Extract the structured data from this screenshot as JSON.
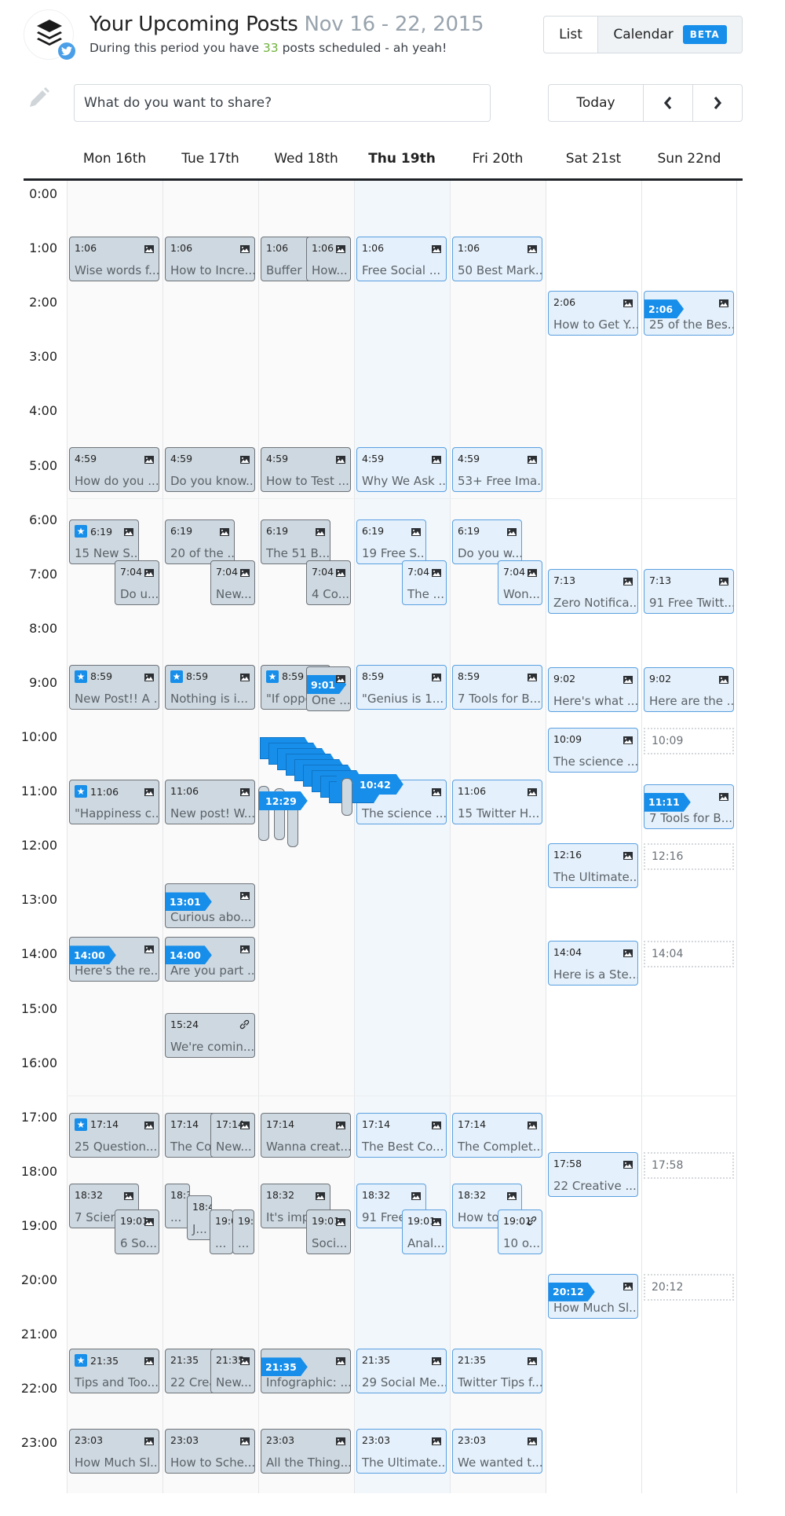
{
  "header": {
    "title": "Your Upcoming Posts",
    "date_range": "Nov 16 - 22, 2015",
    "subtitle_prefix": "During this period you have",
    "post_count": "33",
    "subtitle_suffix": "posts scheduled - ah yeah!",
    "avatar_icon": "buffer-logo-icon",
    "network_badge_icon": "twitter-icon"
  },
  "view_toggle": {
    "list_label": "List",
    "calendar_label": "Calendar",
    "badge": "BETA",
    "active": "Calendar"
  },
  "composer": {
    "icon": "pencil-icon",
    "placeholder": "What do you want to share?",
    "value": ""
  },
  "nav": {
    "today_label": "Today",
    "prev_icon": "chevron-left-icon",
    "next_icon": "chevron-right-icon"
  },
  "colors": {
    "accent": "#168eea",
    "count_green": "#6fb23b",
    "past_event_bg": "#ced8e0",
    "future_event_bg": "#e4f0fb"
  },
  "calendar": {
    "days": [
      {
        "label": "Mon 16th",
        "state": "past"
      },
      {
        "label": "Tue 17th",
        "state": "past"
      },
      {
        "label": "Wed 18th",
        "state": "past"
      },
      {
        "label": "Thu 19th",
        "state": "today"
      },
      {
        "label": "Fri 20th",
        "state": "future"
      },
      {
        "label": "Sat 21st",
        "state": "weekend"
      },
      {
        "label": "Sun 22nd",
        "state": "weekend"
      }
    ],
    "hours": [
      "0:00",
      "1:00",
      "2:00",
      "3:00",
      "4:00",
      "5:00",
      "6:00",
      "7:00",
      "8:00",
      "9:00",
      "10:00",
      "11:00",
      "12:00",
      "13:00",
      "14:00",
      "15:00",
      "16:00",
      "17:00",
      "18:00",
      "19:00",
      "20:00",
      "21:00",
      "22:00",
      "23:00"
    ],
    "events": [
      {
        "day": 0,
        "time": "1:06",
        "text": "Wise words f...",
        "icon": "image-icon"
      },
      {
        "day": 1,
        "time": "1:06",
        "text": "How to Incre...",
        "icon": "image-icon"
      },
      {
        "day": 2,
        "time": "1:06",
        "text": "Buffer c",
        "icon": "image-icon",
        "lane": 0
      },
      {
        "day": 2,
        "time": "1:06",
        "text": "How...",
        "icon": "image-icon",
        "lane": "right-narrow"
      },
      {
        "day": 3,
        "time": "1:06",
        "text": "Free Social ...",
        "icon": "image-icon"
      },
      {
        "day": 4,
        "time": "1:06",
        "text": "50 Best Mark...",
        "icon": "image-icon"
      },
      {
        "day": 5,
        "time": "2:06",
        "text": "How to Get Y...",
        "icon": "image-icon"
      },
      {
        "day": 6,
        "time": "2:06",
        "text": "25 of the Bes...",
        "icon": "image-icon",
        "flag": true
      },
      {
        "day": 0,
        "time": "4:59",
        "text": "How do you ...",
        "icon": "image-icon"
      },
      {
        "day": 1,
        "time": "4:59",
        "text": "Do you know...",
        "icon": "image-icon"
      },
      {
        "day": 2,
        "time": "4:59",
        "text": "How to Test ...",
        "icon": "image-icon"
      },
      {
        "day": 3,
        "time": "4:59",
        "text": "Why We Ask ...",
        "icon": "image-icon"
      },
      {
        "day": 4,
        "time": "4:59",
        "text": "53+ Free Ima...",
        "icon": "image-icon"
      },
      {
        "day": 0,
        "time": "6:19",
        "text": "15 New S...",
        "icon": "image-icon",
        "star": true,
        "lane": "left-wide"
      },
      {
        "day": 0,
        "time": "7:04",
        "text": "Do u...",
        "icon": "image-icon",
        "lane": "right-narrow"
      },
      {
        "day": 1,
        "time": "6:19",
        "text": "20 of the ...",
        "icon": "image-icon",
        "lane": "left-wide"
      },
      {
        "day": 1,
        "time": "7:04",
        "text": "New...",
        "icon": "image-icon",
        "lane": "right-narrow"
      },
      {
        "day": 2,
        "time": "6:19",
        "text": "The 51 B...",
        "icon": "image-icon",
        "lane": "left-wide"
      },
      {
        "day": 2,
        "time": "7:04",
        "text": "4 Co...",
        "icon": "image-icon",
        "lane": "right-narrow"
      },
      {
        "day": 3,
        "time": "6:19",
        "text": "19 Free S...",
        "icon": "image-icon",
        "lane": "left-wide"
      },
      {
        "day": 3,
        "time": "7:04",
        "text": "The ...",
        "icon": "image-icon",
        "lane": "right-narrow"
      },
      {
        "day": 4,
        "time": "6:19",
        "text": "Do you w...",
        "icon": "image-icon",
        "lane": "left-wide"
      },
      {
        "day": 4,
        "time": "7:04",
        "text": "Won...",
        "icon": "image-icon",
        "lane": "right-narrow"
      },
      {
        "day": 5,
        "time": "7:13",
        "text": "Zero Notifica...",
        "icon": "image-icon"
      },
      {
        "day": 6,
        "time": "7:13",
        "text": "91 Free Twitt...",
        "icon": "image-icon"
      },
      {
        "day": 0,
        "time": "8:59",
        "text": "New Post!! A ...",
        "icon": "image-icon",
        "star": true
      },
      {
        "day": 1,
        "time": "8:59",
        "text": "Nothing is i...",
        "icon": "image-icon",
        "star": true
      },
      {
        "day": 2,
        "time": "8:59",
        "text": "\"If oppo",
        "icon": "image-icon",
        "star": true,
        "lane": "left-wide"
      },
      {
        "day": 2,
        "time": "9:01",
        "text": "One ...",
        "icon": "image-icon",
        "flag": true,
        "lane": "right-narrow"
      },
      {
        "day": 3,
        "time": "8:59",
        "text": "\"Genius is 1...",
        "icon": "image-icon"
      },
      {
        "day": 4,
        "time": "8:59",
        "text": "7 Tools for B...",
        "icon": "image-icon"
      },
      {
        "day": 5,
        "time": "9:02",
        "text": "Here's what ...",
        "icon": "image-icon"
      },
      {
        "day": 6,
        "time": "9:02",
        "text": "Here are the ...",
        "icon": "image-icon"
      },
      {
        "day": 5,
        "time": "10:09",
        "text": "The science ...",
        "icon": "image-icon"
      },
      {
        "day": 0,
        "time": "11:06",
        "text": "\"Happiness c...",
        "icon": "image-icon",
        "star": true
      },
      {
        "day": 1,
        "time": "11:06",
        "text": "New post! W...",
        "icon": "image-icon"
      },
      {
        "day": 3,
        "time": "11:06",
        "text": "The science ...",
        "icon": "image-icon"
      },
      {
        "day": 4,
        "time": "11:06",
        "text": "15 Twitter H...",
        "icon": "image-icon"
      },
      {
        "day": 6,
        "time": "11:11",
        "text": "7 Tools for B...",
        "icon": "image-icon",
        "flag": true
      },
      {
        "day": 5,
        "time": "12:16",
        "text": "The Ultimate...",
        "icon": "image-icon"
      },
      {
        "day": 1,
        "time": "13:01",
        "text": "Curious abo...",
        "icon": "image-icon",
        "flag": true
      },
      {
        "day": 0,
        "time": "14:00",
        "text": "Here's the re...",
        "icon": "image-icon",
        "flag": true
      },
      {
        "day": 1,
        "time": "14:00",
        "text": "Are you part ...",
        "icon": "image-icon",
        "flag": true
      },
      {
        "day": 5,
        "time": "14:04",
        "text": "Here is a Ste...",
        "icon": "image-icon"
      },
      {
        "day": 1,
        "time": "15:24",
        "text": "We're comin...",
        "icon": "link-icon"
      },
      {
        "day": 0,
        "time": "17:14",
        "text": "25 Question...",
        "icon": "image-icon",
        "star": true
      },
      {
        "day": 1,
        "time": "17:14",
        "text": "The Cor",
        "icon": "image-icon",
        "lane": 0
      },
      {
        "day": 1,
        "time": "17:14",
        "text": "New...",
        "icon": "image-icon",
        "lane": "right-narrow"
      },
      {
        "day": 2,
        "time": "17:14",
        "text": "Wanna creat...",
        "icon": "image-icon"
      },
      {
        "day": 3,
        "time": "17:14",
        "text": "The Best Co...",
        "icon": "image-icon"
      },
      {
        "day": 4,
        "time": "17:14",
        "text": "The Complet...",
        "icon": "image-icon"
      },
      {
        "day": 5,
        "time": "17:58",
        "text": "22 Creative ...",
        "icon": "image-icon"
      },
      {
        "day": 0,
        "time": "18:32",
        "text": "7 Scienc",
        "icon": "image-icon",
        "lane": "left-wide"
      },
      {
        "day": 0,
        "time": "19:01",
        "text": "6 So...",
        "icon": "image-icon",
        "lane": "right-narrow"
      },
      {
        "day": 1,
        "time": "18:3",
        "text": "...",
        "lane": "q0"
      },
      {
        "day": 1,
        "time": "18:4",
        "text": "J...",
        "lane": "q1"
      },
      {
        "day": 1,
        "time": "19:0",
        "text": "...",
        "lane": "q2"
      },
      {
        "day": 1,
        "time": "19:",
        "text": "...",
        "lane": "q3"
      },
      {
        "day": 2,
        "time": "18:32",
        "text": "It's impo",
        "icon": "image-icon",
        "lane": "left-wide"
      },
      {
        "day": 2,
        "time": "19:01",
        "text": "Soci...",
        "icon": "image-icon",
        "lane": "right-narrow"
      },
      {
        "day": 3,
        "time": "18:32",
        "text": "91 Free",
        "icon": "image-icon",
        "lane": "left-wide"
      },
      {
        "day": 3,
        "time": "19:01",
        "text": "Anal...",
        "icon": "image-icon",
        "lane": "right-narrow"
      },
      {
        "day": 4,
        "time": "18:32",
        "text": "How to",
        "icon": "image-icon",
        "lane": "left-wide"
      },
      {
        "day": 4,
        "time": "19:01",
        "text": "10 o...",
        "icon": "link-icon",
        "lane": "right-narrow"
      },
      {
        "day": 5,
        "time": "20:12",
        "text": "How Much Sl...",
        "icon": "image-icon",
        "flag": true
      },
      {
        "day": 0,
        "time": "21:35",
        "text": "Tips and Too...",
        "icon": "image-icon",
        "star": true
      },
      {
        "day": 1,
        "time": "21:35",
        "text": "22 Crea",
        "icon": "image-icon",
        "lane": 0
      },
      {
        "day": 1,
        "time": "21:35",
        "text": "New...",
        "icon": "image-icon",
        "lane": "right-narrow"
      },
      {
        "day": 2,
        "time": "21:35",
        "text": "Infographic: ...",
        "icon": "image-icon",
        "flag": true
      },
      {
        "day": 3,
        "time": "21:35",
        "text": "29 Social Me...",
        "icon": "image-icon"
      },
      {
        "day": 4,
        "time": "21:35",
        "text": "Twitter Tips f...",
        "icon": "image-icon"
      },
      {
        "day": 0,
        "time": "23:03",
        "text": "How Much Sl...",
        "icon": "image-icon"
      },
      {
        "day": 1,
        "time": "23:03",
        "text": "How to Sche...",
        "icon": "image-icon"
      },
      {
        "day": 2,
        "time": "23:03",
        "text": "All the Thing...",
        "icon": "image-icon"
      },
      {
        "day": 3,
        "time": "23:03",
        "text": "The Ultimate...",
        "icon": "image-icon"
      },
      {
        "day": 4,
        "time": "23:03",
        "text": "We wanted t...",
        "icon": "image-icon"
      }
    ],
    "empty_slots": [
      {
        "day": 6,
        "time": "10:09"
      },
      {
        "day": 6,
        "time": "12:16"
      },
      {
        "day": 6,
        "time": "14:04"
      },
      {
        "day": 6,
        "time": "17:58"
      },
      {
        "day": 6,
        "time": "20:12"
      }
    ],
    "drag_stack": {
      "day": 2,
      "label": "10:42",
      "star": true,
      "secondary_label": "12:29"
    }
  }
}
